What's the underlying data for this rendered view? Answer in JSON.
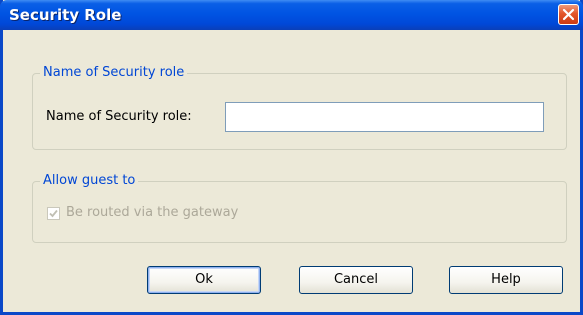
{
  "window": {
    "title": "Security Role"
  },
  "name_group": {
    "legend": "Name of Security role",
    "field_label": "Name of Security role:",
    "field_value": "",
    "field_placeholder": ""
  },
  "guest_group": {
    "legend": "Allow guest to",
    "checkbox_label": "Be routed via the gateway",
    "checkbox_checked": true,
    "checkbox_disabled": true
  },
  "buttons": {
    "ok": "Ok",
    "cancel": "Cancel",
    "help": "Help"
  },
  "colors": {
    "titlebar": "#0054e3",
    "legend_text": "#0046d5",
    "disabled_text": "#aca899",
    "dialog_bg": "#ece9d8",
    "close_button": "#e3562b"
  },
  "icons": {
    "close": "close-icon",
    "check": "checkmark-icon"
  }
}
